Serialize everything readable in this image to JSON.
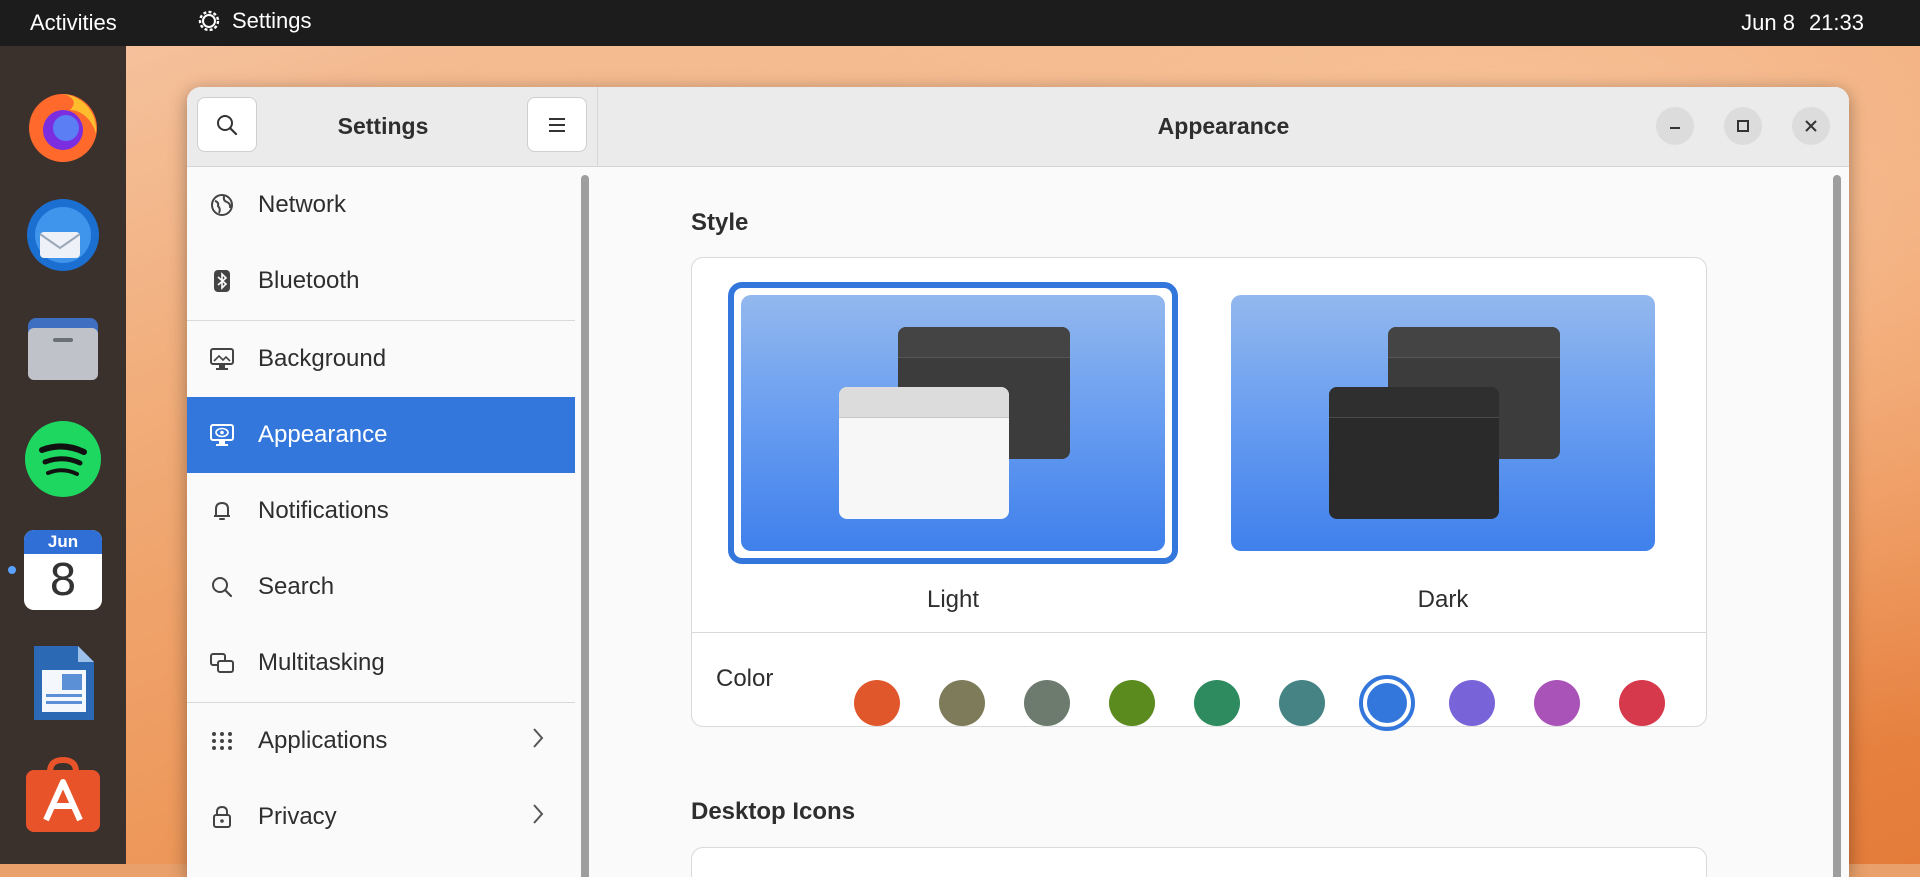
{
  "topbar": {
    "activities": "Activities",
    "app_name": "Settings",
    "date": "Jun 8",
    "time": "21:33"
  },
  "dock": {
    "items": [
      {
        "name": "Firefox"
      },
      {
        "name": "Thunderbird"
      },
      {
        "name": "Files"
      },
      {
        "name": "Spotify"
      },
      {
        "name": "Calendar",
        "month": "Jun",
        "day": "8"
      },
      {
        "name": "LibreOffice Writer"
      },
      {
        "name": "App Center"
      }
    ]
  },
  "window": {
    "sidebar_title": "Settings",
    "content_title": "Appearance"
  },
  "sidebar": {
    "items": [
      {
        "label": "Network",
        "icon": "network-icon"
      },
      {
        "label": "Bluetooth",
        "icon": "bluetooth-icon"
      },
      {
        "label": "Background",
        "icon": "background-icon"
      },
      {
        "label": "Appearance",
        "icon": "appearance-icon",
        "active": true
      },
      {
        "label": "Notifications",
        "icon": "bell-icon"
      },
      {
        "label": "Search",
        "icon": "search-icon"
      },
      {
        "label": "Multitasking",
        "icon": "multitasking-icon"
      },
      {
        "label": "Applications",
        "icon": "apps-grid-icon",
        "chevron": true
      },
      {
        "label": "Privacy",
        "icon": "lock-icon",
        "chevron": true
      }
    ]
  },
  "appearance": {
    "style_title": "Style",
    "style_options": [
      {
        "label": "Light",
        "selected": true
      },
      {
        "label": "Dark",
        "selected": false
      }
    ],
    "color_label": "Color",
    "colors": [
      {
        "name": "orange",
        "hex": "#e0572c"
      },
      {
        "name": "bark",
        "hex": "#7d7b59"
      },
      {
        "name": "sage",
        "hex": "#6c7b6e"
      },
      {
        "name": "olive",
        "hex": "#5b8a1f"
      },
      {
        "name": "viridian",
        "hex": "#2e8a5f"
      },
      {
        "name": "prussian-green",
        "hex": "#458385"
      },
      {
        "name": "blue",
        "hex": "#3477dc",
        "selected": true
      },
      {
        "name": "purple",
        "hex": "#7864d8"
      },
      {
        "name": "magenta",
        "hex": "#a952b7"
      },
      {
        "name": "red",
        "hex": "#d6394b"
      }
    ],
    "desktop_icons_title": "Desktop Icons"
  },
  "colors": {
    "accent": "#3477dc",
    "topbar": "#1c1c1c",
    "dock": "#3a302c"
  }
}
